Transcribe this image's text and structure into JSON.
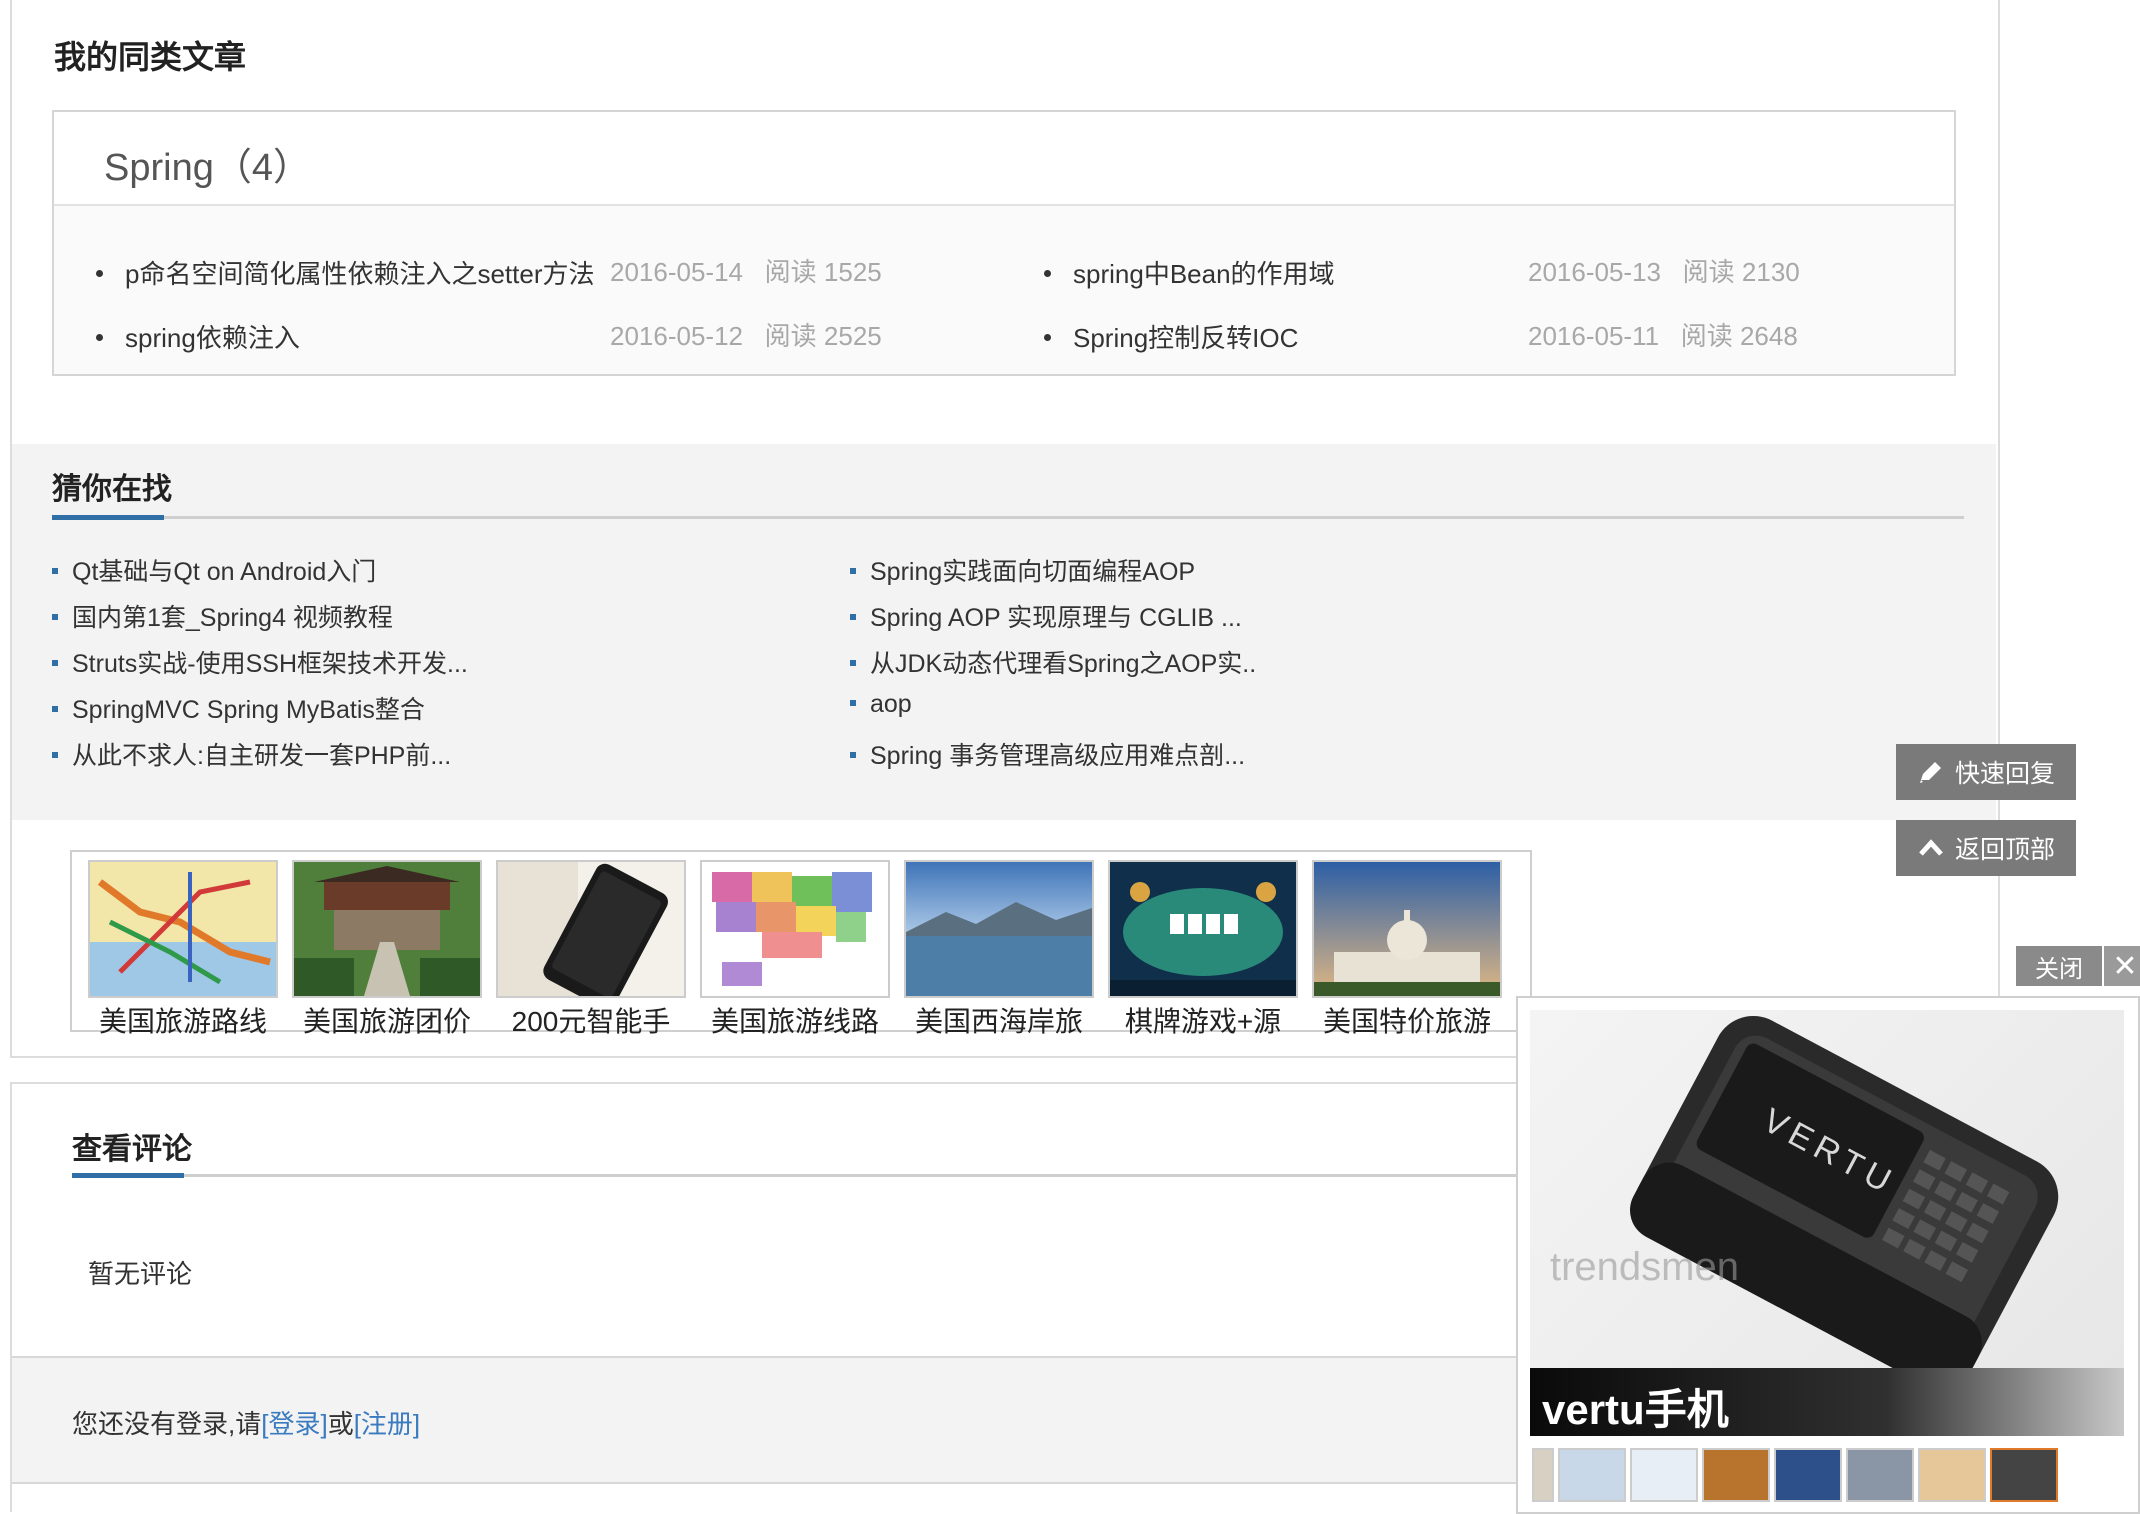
{
  "similar": {
    "heading": "我的同类文章",
    "category_title": "Spring（4）",
    "articles": [
      {
        "title": "p命名空间简化属性依赖注入之setter方法",
        "date": "2016-05-14",
        "reads": "阅读 1525"
      },
      {
        "title": "spring中Bean的作用域",
        "date": "2016-05-13",
        "reads": "阅读 2130"
      },
      {
        "title": "spring依赖注入",
        "date": "2016-05-12",
        "reads": "阅读 2525"
      },
      {
        "title": "Spring控制反转IOC",
        "date": "2016-05-11",
        "reads": "阅读 2648"
      }
    ]
  },
  "guess": {
    "heading": "猜你在找",
    "items": [
      "Qt基础与Qt on Android入门",
      "Spring实践面向切面编程AOP",
      "国内第1套_Spring4 视频教程",
      "Spring AOP 实现原理与 CGLIB ...",
      "Struts实战-使用SSH框架技术开发...",
      "从JDK动态代理看Spring之AOP实..",
      "SpringMVC Spring MyBatis整合",
      "aop",
      "从此不求人:自主研发一套PHP前...",
      "Spring 事务管理高级应用难点剖..."
    ]
  },
  "ads": {
    "captions": [
      "美国旅游路线",
      "美国旅游团价",
      "200元智能手",
      "美国旅游线路",
      "美国西海岸旅",
      "棋牌游戏+源",
      "美国特价旅游"
    ]
  },
  "comments": {
    "heading": "查看评论",
    "empty_text": "暂无评论",
    "login_prefix": "您还没有登录,请",
    "login_link": "[登录]",
    "or_text": "或",
    "register_link": "[注册]"
  },
  "side": {
    "quick_reply": "快速回复",
    "back_top": "返回顶部"
  },
  "popup": {
    "close_label": "关闭",
    "close_icon": "✕",
    "caption": "vertu手机",
    "brand_text": "VERTU",
    "watermark": "trendsmen"
  }
}
